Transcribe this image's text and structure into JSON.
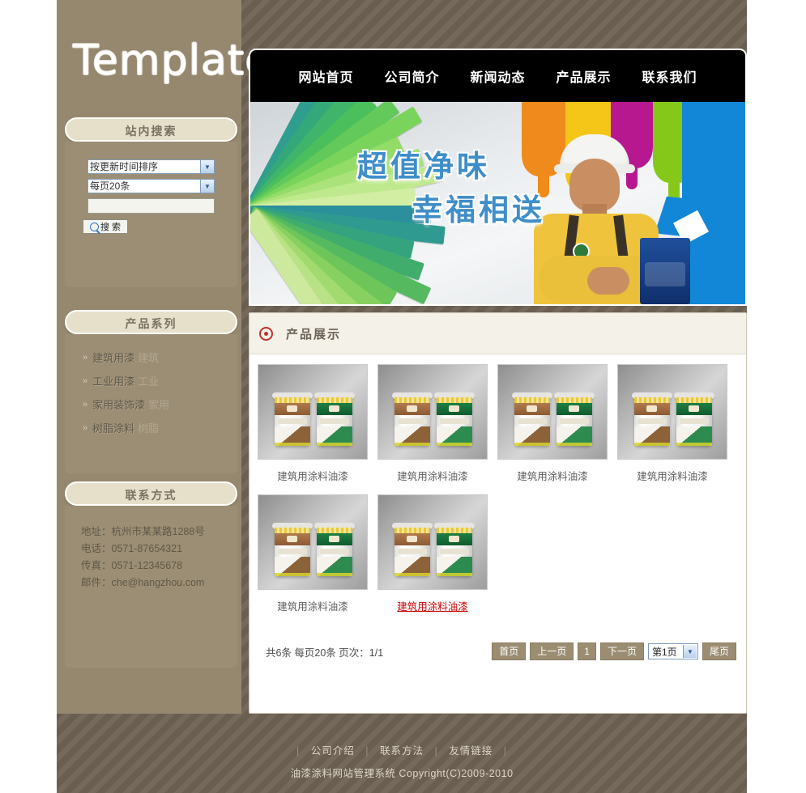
{
  "site": {
    "logo_text": "Template"
  },
  "nav": {
    "items": [
      {
        "label": "网站首页"
      },
      {
        "label": "公司简介"
      },
      {
        "label": "新闻动态"
      },
      {
        "label": "产品展示"
      },
      {
        "label": "联系我们"
      }
    ]
  },
  "banner": {
    "line1": "超值净味",
    "line2": "幸福相送"
  },
  "search_panel": {
    "title": "站内搜索",
    "sort_select": "按更新时间排序",
    "perpage_select": "每页20条",
    "keyword_value": "",
    "keyword_placeholder": "",
    "button_label": "搜 索",
    "icon": "search-icon"
  },
  "series_panel": {
    "title": "产品系列",
    "items": [
      {
        "label": "建筑用漆",
        "ghost": "建筑"
      },
      {
        "label": "工业用漆",
        "ghost": "工业"
      },
      {
        "label": "家用装饰漆",
        "ghost": "家用"
      },
      {
        "label": "树脂涂料",
        "ghost": "树脂"
      }
    ],
    "bullet": "»"
  },
  "contact_panel": {
    "title": "联系方式",
    "lines": [
      "地址：杭州市某某路1288号",
      "电话：0571-87654321",
      "传真：0571-12345678",
      "邮件：che@hangzhou.com"
    ]
  },
  "content": {
    "title": "产品展示",
    "icon": "bullseye-icon",
    "products": [
      {
        "caption": "建筑用涂料油漆",
        "active": false
      },
      {
        "caption": "建筑用涂料油漆",
        "active": false
      },
      {
        "caption": "建筑用涂料油漆",
        "active": false
      },
      {
        "caption": "建筑用涂料油漆",
        "active": false
      },
      {
        "caption": "建筑用涂料油漆",
        "active": false
      },
      {
        "caption": "建筑用涂料油漆",
        "active": true
      }
    ]
  },
  "pagination": {
    "info": "共6条 每页20条 页次：1/1",
    "first": "首页",
    "prev": "上一页",
    "current_page": "1",
    "next": "下一页",
    "page_select": "第1页",
    "last": "尾页"
  },
  "footer": {
    "sep": "|",
    "links": [
      {
        "label": "公司介绍"
      },
      {
        "label": "联系方法"
      },
      {
        "label": "友情链接"
      }
    ],
    "copyright": "油漆涂料网站管理系统  Copyright(C)2009-2010"
  },
  "colors": {
    "page_bg": "#6e6254",
    "sidebar": "#96886f",
    "panel_body": "#9c8e74",
    "panel_head": "#e6e0cb",
    "nav_bg": "#000000",
    "accent_red": "#c2342b",
    "banner_text": "#3f8ec9",
    "pager_btn": "#9b8d71"
  }
}
